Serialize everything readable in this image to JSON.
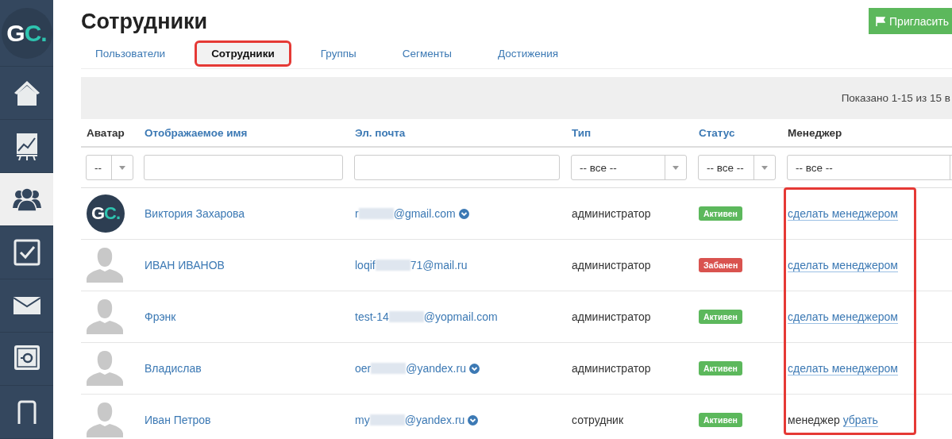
{
  "sidebar": {
    "logo": [
      "G",
      "C."
    ],
    "items": [
      {
        "selected": false
      },
      {
        "selected": false
      },
      {
        "selected": true
      },
      {
        "selected": false
      },
      {
        "selected": false
      },
      {
        "selected": false
      },
      {
        "selected": false
      }
    ]
  },
  "page": {
    "title": "Сотрудники",
    "invite_button": "Пригласить"
  },
  "tabs": [
    {
      "label": "Пользователи",
      "selected": false,
      "highlighted": false
    },
    {
      "label": "Сотрудники",
      "selected": true,
      "highlighted": true
    },
    {
      "label": "Группы",
      "selected": false,
      "highlighted": false
    },
    {
      "label": "Сегменты",
      "selected": false,
      "highlighted": false
    },
    {
      "label": "Достижения",
      "selected": false,
      "highlighted": false
    }
  ],
  "summary": "Показано 1-15 из 15 в",
  "table": {
    "columns": [
      {
        "label": "Аватар",
        "sortable": false
      },
      {
        "label": "Отображаемое имя",
        "sortable": true
      },
      {
        "label": "Эл. почта",
        "sortable": true
      },
      {
        "label": "Тип",
        "sortable": true
      },
      {
        "label": "Статус",
        "sortable": true
      },
      {
        "label": "Менеджер",
        "sortable": false
      }
    ],
    "filters": [
      {
        "kind": "select",
        "value": "--"
      },
      {
        "kind": "text"
      },
      {
        "kind": "text"
      },
      {
        "kind": "select",
        "value": "-- все --"
      },
      {
        "kind": "select",
        "value": "-- все --"
      },
      {
        "kind": "select",
        "value": "-- все --"
      }
    ],
    "manager_column_highlighted": true,
    "rows": [
      {
        "avatar": {
          "kind": "logo",
          "letters": [
            "G",
            "C."
          ]
        },
        "name": "Виктория Захарова",
        "email": {
          "start": "r",
          "end": "@gmail.com"
        },
        "verified": true,
        "type": "администратор",
        "status": {
          "label": "Активен",
          "color": "#5cb85c"
        },
        "manager": {
          "kind": "action",
          "link": "сделать менеджером"
        }
      },
      {
        "avatar": {
          "kind": "placeholder"
        },
        "name": "ИВАН ИВАНОВ",
        "email": {
          "start": "loqif",
          "end": "71@mail.ru"
        },
        "verified": false,
        "type": "администратор",
        "status": {
          "label": "Забанен",
          "color": "#d9534f"
        },
        "manager": {
          "kind": "action",
          "link": "сделать менеджером"
        }
      },
      {
        "avatar": {
          "kind": "placeholder"
        },
        "name": "Фрэнк",
        "email": {
          "start": "test-14",
          "end": "@yopmail.com"
        },
        "verified": false,
        "type": "администратор",
        "status": {
          "label": "Активен",
          "color": "#5cb85c"
        },
        "manager": {
          "kind": "action",
          "link": "сделать менеджером"
        }
      },
      {
        "avatar": {
          "kind": "placeholder"
        },
        "name": "Владислав",
        "email": {
          "start": "oer",
          "end": "@yandex.ru"
        },
        "verified": true,
        "type": "администратор",
        "status": {
          "label": "Активен",
          "color": "#5cb85c"
        },
        "manager": {
          "kind": "action",
          "link": "сделать менеджером"
        }
      },
      {
        "avatar": {
          "kind": "placeholder"
        },
        "name": "Иван Петров",
        "email": {
          "start": "my",
          "end": "@yandex.ru"
        },
        "verified": true,
        "type": "сотрудник",
        "status": {
          "label": "Активен",
          "color": "#5cb85c"
        },
        "manager": {
          "kind": "manager",
          "text": "менеджер",
          "link": "убрать"
        }
      }
    ]
  }
}
